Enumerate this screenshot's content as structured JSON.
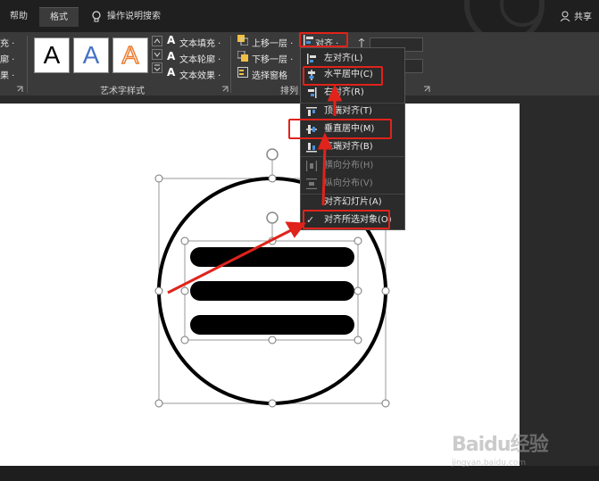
{
  "tabs": {
    "help": "帮助",
    "format": "格式",
    "tell_me": "操作说明搜索",
    "share": "共享"
  },
  "ribbon": {
    "left_partial": [
      "充 ·",
      "廓 ·",
      "果 ·"
    ],
    "wordart_samples": [
      "A",
      "A",
      "A"
    ],
    "text_fill": "文本填充 ·",
    "text_outline": "文本轮廓 ·",
    "text_effects": "文本效果 ·",
    "wordart_group": "艺术字样式",
    "bring_forward": "上移一层 ·",
    "send_backward": "下移一层 ·",
    "selection_pane": "选择窗格",
    "arrange_group": "排列",
    "align_button": "对齐 ·"
  },
  "align_menu": {
    "items": [
      {
        "label": "左对齐(L)",
        "enabled": true
      },
      {
        "label": "水平居中(C)",
        "enabled": true
      },
      {
        "label": "右对齐(R)",
        "enabled": true
      },
      {
        "label": "顶端对齐(T)",
        "enabled": true
      },
      {
        "label": "垂直居中(M)",
        "enabled": true
      },
      {
        "label": "底端对齐(B)",
        "enabled": true
      },
      {
        "label": "横向分布(H)",
        "enabled": false
      },
      {
        "label": "纵向分布(V)",
        "enabled": false
      },
      {
        "label": "对齐幻灯片(A)",
        "enabled": true
      },
      {
        "label": "对齐所选对象(O)",
        "enabled": true,
        "checked": true
      }
    ],
    "check_mark": "✓"
  },
  "watermark": {
    "brand": "Baidu",
    "brand_cn": "经验",
    "url": "jingyan.baidu.com"
  },
  "colors": {
    "highlight": "#e0231b",
    "arrow": "#e0231b"
  }
}
